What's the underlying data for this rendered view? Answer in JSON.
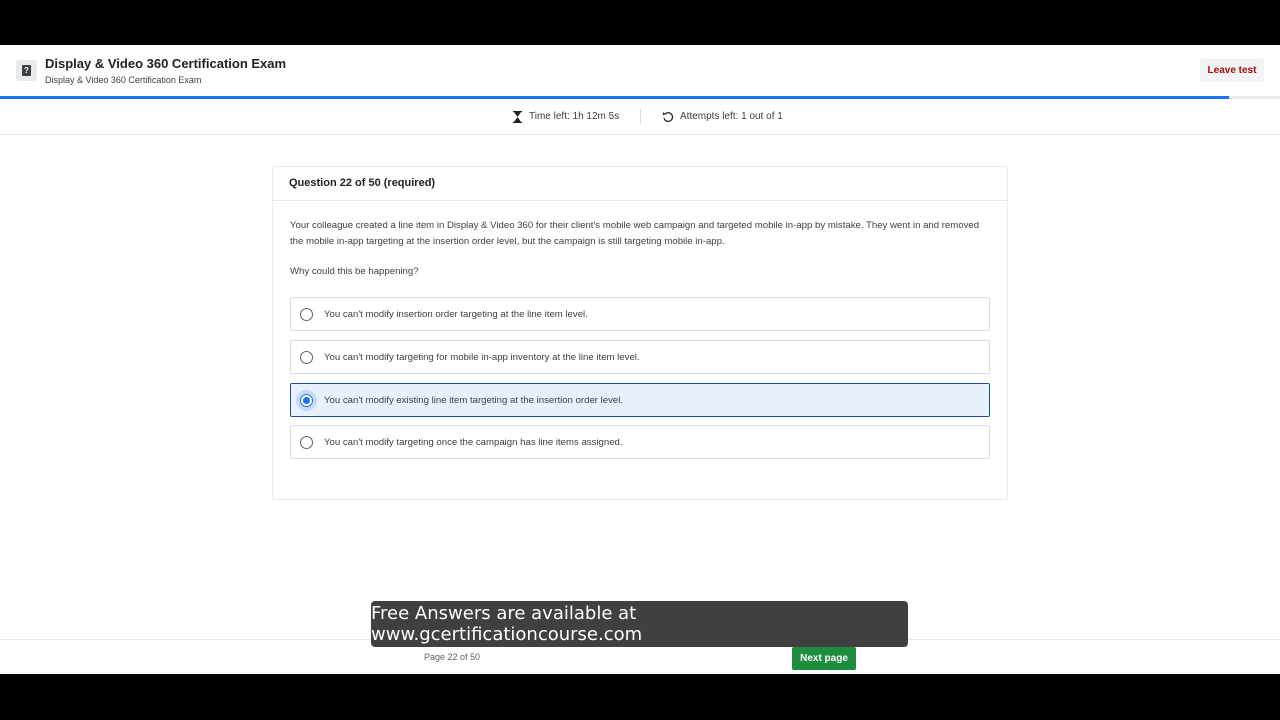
{
  "header": {
    "title": "Display & Video 360 Certification Exam",
    "subtitle": "Display & Video 360 Certification Exam",
    "leave_label": "Leave test",
    "icon": "exam-book-icon"
  },
  "progress": {
    "fraction": 0.96,
    "color": "#1a73e8"
  },
  "infobar": {
    "time_left": "Time left: 1h 12m 5s",
    "attempts_left": "Attempts left: 1 out of 1",
    "time_icon": "hourglass-icon",
    "attempts_icon": "refresh-icon"
  },
  "question": {
    "number_label": "Question 22 of 50 (required)",
    "text": "Your colleague created a line item in Display & Video 360 for their client's mobile web campaign and targeted mobile in-app by mistake. They went in and removed the mobile in-app targeting at the insertion order level, but the campaign is still targeting mobile in-app.",
    "prompt": "Why could this be happening?",
    "options": [
      {
        "label": "You can't modify insertion order targeting at the line item level.",
        "selected": false
      },
      {
        "label": "You can't modify targeting for mobile in-app inventory at the line item level.",
        "selected": false
      },
      {
        "label": "You can't modify existing line item targeting at the insertion order level.",
        "selected": true
      },
      {
        "label": "You can't modify targeting once the campaign has line items assigned.",
        "selected": false
      }
    ]
  },
  "footer": {
    "page_label": "Page 22 of 50",
    "next_label": "Next page",
    "next_color": "#1e8e3e"
  },
  "caption": {
    "text": "Free Answers are available at www.gcertificationcourse.com"
  }
}
